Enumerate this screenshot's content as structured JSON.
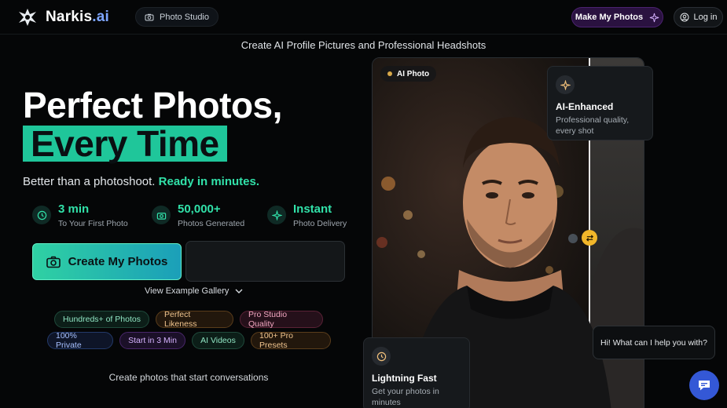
{
  "header": {
    "logo_text": "Narkis",
    "logo_suffix": ".ai",
    "nav_pill": "Photo Studio",
    "make_button": "Make My Photos",
    "login_button": "Log in"
  },
  "tagline": "Create AI Profile Pictures and Professional Headshots",
  "hero": {
    "title_line1": "Perfect Photos,",
    "title_line2": "Every Time",
    "subhead_plain": "Better than a photoshoot.",
    "subhead_accent": "Ready in minutes."
  },
  "stats": [
    {
      "value": "3 min",
      "label": "To Your First Photo",
      "icon": "clock-icon"
    },
    {
      "value": "50,000+",
      "label": "Photos Generated",
      "icon": "camera-icon"
    },
    {
      "value": "Instant",
      "label": "Photo Delivery",
      "icon": "sparkle-icon"
    }
  ],
  "cta": {
    "label": "Create My Photos",
    "gallery_link": "View Example Gallery"
  },
  "chips": [
    {
      "label": "Hundreds+ of Photos"
    },
    {
      "label": "Perfect Likeness"
    },
    {
      "label": "Pro Studio Quality"
    },
    {
      "label": "100% Private"
    },
    {
      "label": "Start in 3 Min"
    },
    {
      "label": "AI Videos"
    },
    {
      "label": "100+ Pro Presets"
    }
  ],
  "bottom_line": "Create photos that start conversations",
  "showcase": {
    "badge": "AI Photo",
    "enhanced": {
      "title": "AI-Enhanced",
      "desc_line1": "Professional quality,",
      "desc_line2": "every shot"
    },
    "fast": {
      "title": "Lightning Fast",
      "desc_line1": "Get your photos in",
      "desc_line2": "minutes"
    }
  },
  "chat": {
    "greeting": "Hi! What can I help you with?"
  },
  "colors": {
    "accent_green": "#31e1a9",
    "highlight": "#1fc69a",
    "chat_blue": "#3458d6",
    "swap_yellow": "#f1b62a"
  }
}
